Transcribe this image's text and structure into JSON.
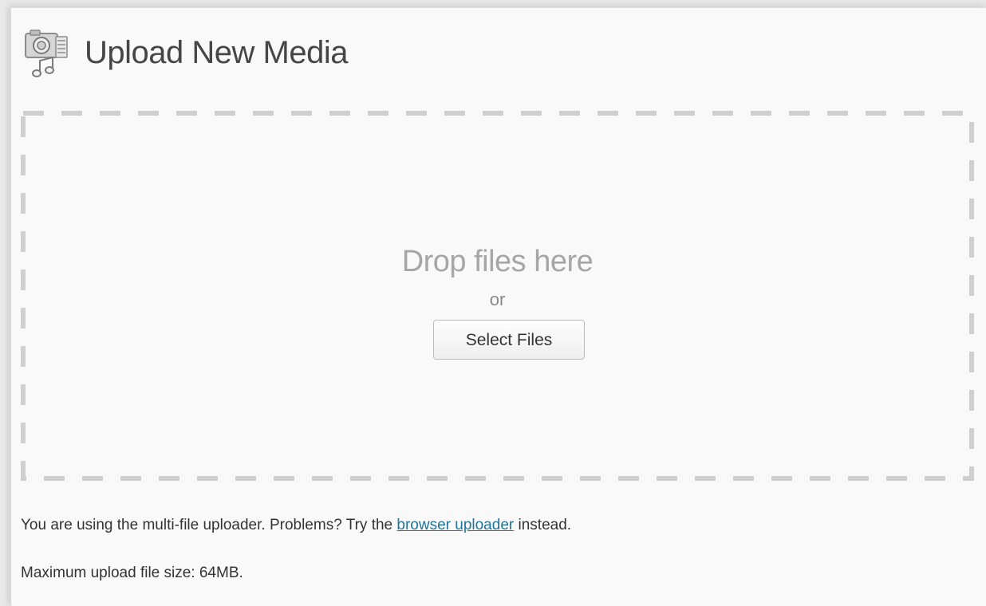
{
  "header": {
    "title": "Upload New Media",
    "icon": "media-library-icon"
  },
  "drop_zone": {
    "title": "Drop files here",
    "or_text": "or",
    "select_button_label": "Select Files"
  },
  "notes": {
    "uploader_prefix": "You are using the multi-file uploader. Problems? Try the ",
    "uploader_link": "browser uploader",
    "uploader_suffix": " instead.",
    "max_size": "Maximum upload file size: 64MB."
  },
  "colors": {
    "link": "#21759b",
    "dashed_border": "#cfcfcf",
    "title_text": "#464646",
    "drop_text": "#a6a6a6"
  }
}
